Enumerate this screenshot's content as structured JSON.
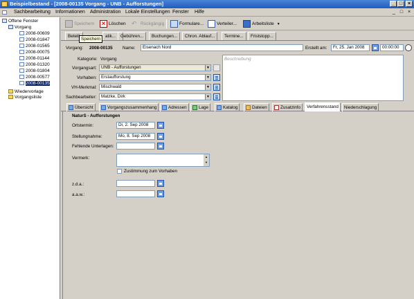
{
  "window": {
    "title": "Beispielbestand - [2008-00135 Vorgang - UNB - Aufforstungen]"
  },
  "menu": [
    "Sachbearbeitung",
    "Informationen",
    "Administration",
    "Lokale Einstellungen",
    "Fenster",
    "Hilfe"
  ],
  "sidebar": {
    "root": "Offene Fenster",
    "group": "Vorgang",
    "items": [
      "2008-00609",
      "2008-01847",
      "2008-01565",
      "2008-00075",
      "2008-01144",
      "2008-01320",
      "2008-01804",
      "2008-00577",
      "2008-00135"
    ],
    "selected_index": 8,
    "extra": [
      "Wiedervorlage",
      "Vorgangsliste"
    ]
  },
  "toolbar": {
    "speichern": "Speichern",
    "loeschen": "Löschen",
    "rueckgaengig": "Rückgängig",
    "formulare": "Formulare...",
    "verteiler": "Verteiler...",
    "arbeitsliste": "Arbeitsliste",
    "tooltip": "Speichern"
  },
  "subtabs": [
    "Beteili",
    "atik...",
    "Gebühren...",
    "Buchungen...",
    "Chron. Ablauf...",
    "Termine...",
    "Friststopp..."
  ],
  "header": {
    "vorgang_label": "Vorgang:",
    "vorgang_value": "2008-00135",
    "name_label": "Name:",
    "name_value": "Eisenach Nord",
    "erstellt_label": "Erstellt am:",
    "erstellt_date": "Fr, 25. Jan 2008",
    "erstellt_time": "00:00:00"
  },
  "form": {
    "kategorie_label": "Kategorie:",
    "kategorie_value": "Vorgang",
    "vorgangsart_label": "Vorgangsart:",
    "vorgangsart_value": "UNB - Aufforstungen",
    "vorhaben_label": "Vorhaben:",
    "vorhaben_value": "Erstaufforstung",
    "vh_label": "VH-Merkmal:",
    "vh_value": "Mischwald",
    "sb_label": "Sachbearbeiter:",
    "sb_value": "Matzke, Dirk",
    "beschreibung_placeholder": "Beschreibung"
  },
  "tabs": [
    "Übersicht",
    "Vorgangszusammenhang",
    "Adressen",
    "Lage",
    "Katalog",
    "Dateien",
    "Zusatzinfo",
    "Verfahrensstand",
    "Niederschlagung"
  ],
  "active_tab": "Verfahrensstand",
  "panel": {
    "title": "NaturS - Aufforstungen",
    "ortstermin_label": "Ortstermin:",
    "ortstermin_value": "Di, 2. Sep 2008",
    "stellung_label": "Stellungnahme:",
    "stellung_value": "Mo, 8. Sep 2008",
    "fehlende_label": "Fehlende Unterlagen:",
    "fehlende_value": "",
    "vermerk_label": "Vermerk:",
    "zustimmung_label": "Zustimmung zum Vorhaben",
    "zda_label": "z.d.a.:",
    "aaw_label": "a.a.w.:"
  }
}
